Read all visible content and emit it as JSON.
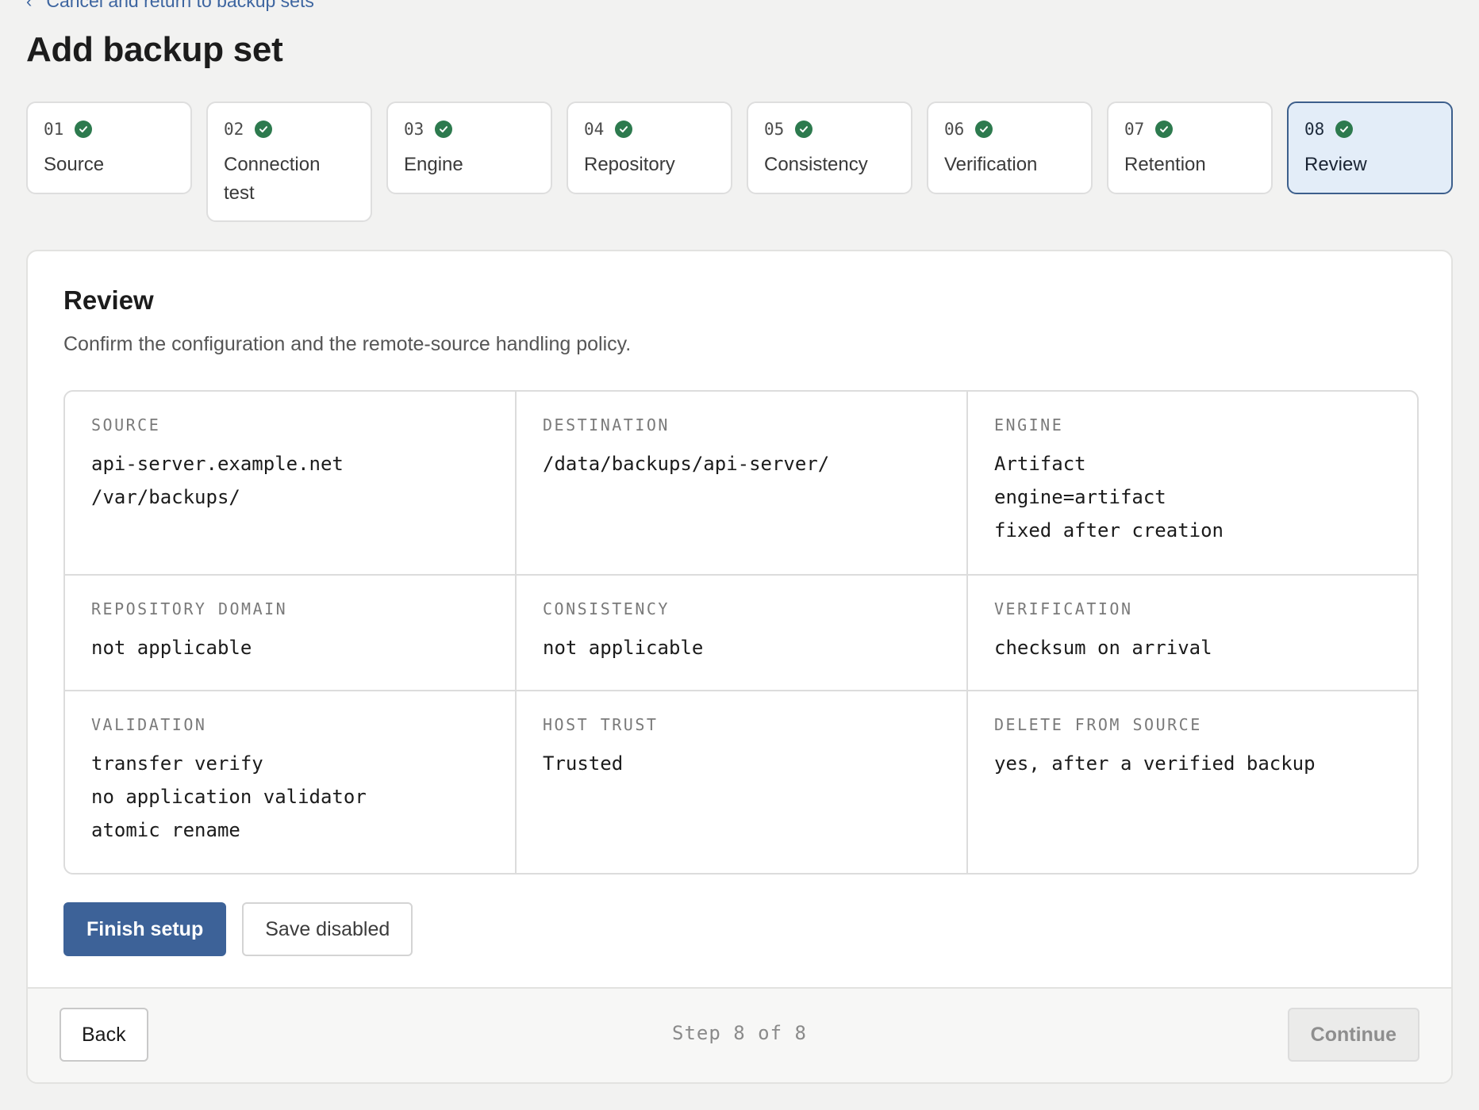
{
  "nav": {
    "back_link": "Cancel and return to backup sets"
  },
  "page": {
    "title": "Add backup set"
  },
  "steps": [
    {
      "num": "01",
      "label": "Source",
      "status": "complete"
    },
    {
      "num": "02",
      "label": "Connection test",
      "status": "complete"
    },
    {
      "num": "03",
      "label": "Engine",
      "status": "complete"
    },
    {
      "num": "04",
      "label": "Repository",
      "status": "complete"
    },
    {
      "num": "05",
      "label": "Consistency",
      "status": "complete"
    },
    {
      "num": "06",
      "label": "Verification",
      "status": "complete"
    },
    {
      "num": "07",
      "label": "Retention",
      "status": "complete"
    },
    {
      "num": "08",
      "label": "Review",
      "status": "complete",
      "active": true
    }
  ],
  "review": {
    "title": "Review",
    "subtitle": "Confirm the configuration and the remote-source handling policy.",
    "cells": [
      {
        "key": "SOURCE",
        "lines": [
          "api-server.example.net",
          "/var/backups/"
        ]
      },
      {
        "key": "DESTINATION",
        "lines": [
          "/data/backups/api-server/"
        ]
      },
      {
        "key": "ENGINE",
        "lines": [
          "Artifact",
          "engine=artifact",
          "fixed after creation"
        ]
      },
      {
        "key": "REPOSITORY DOMAIN",
        "lines": [
          "not applicable"
        ]
      },
      {
        "key": "CONSISTENCY",
        "lines": [
          "not applicable"
        ]
      },
      {
        "key": "VERIFICATION",
        "lines": [
          "checksum on arrival"
        ]
      },
      {
        "key": "VALIDATION",
        "lines": [
          "transfer verify",
          "no application validator",
          "atomic rename"
        ]
      },
      {
        "key": "HOST TRUST",
        "lines": [
          "Trusted"
        ]
      },
      {
        "key": "DELETE FROM SOURCE",
        "lines": [
          "yes, after a verified backup"
        ]
      }
    ],
    "finish_label": "Finish setup",
    "save_label": "Save disabled"
  },
  "footer": {
    "back_label": "Back",
    "step_counter": "Step 8 of 8",
    "continue_label": "Continue"
  },
  "colors": {
    "accent": "#3d6298",
    "check": "#2d7a4e",
    "active_step_bg": "#e3edf8",
    "link": "#3d65a0"
  },
  "icons": {
    "back_link": "chevron-left-icon",
    "step_status": "check-circle-icon"
  }
}
